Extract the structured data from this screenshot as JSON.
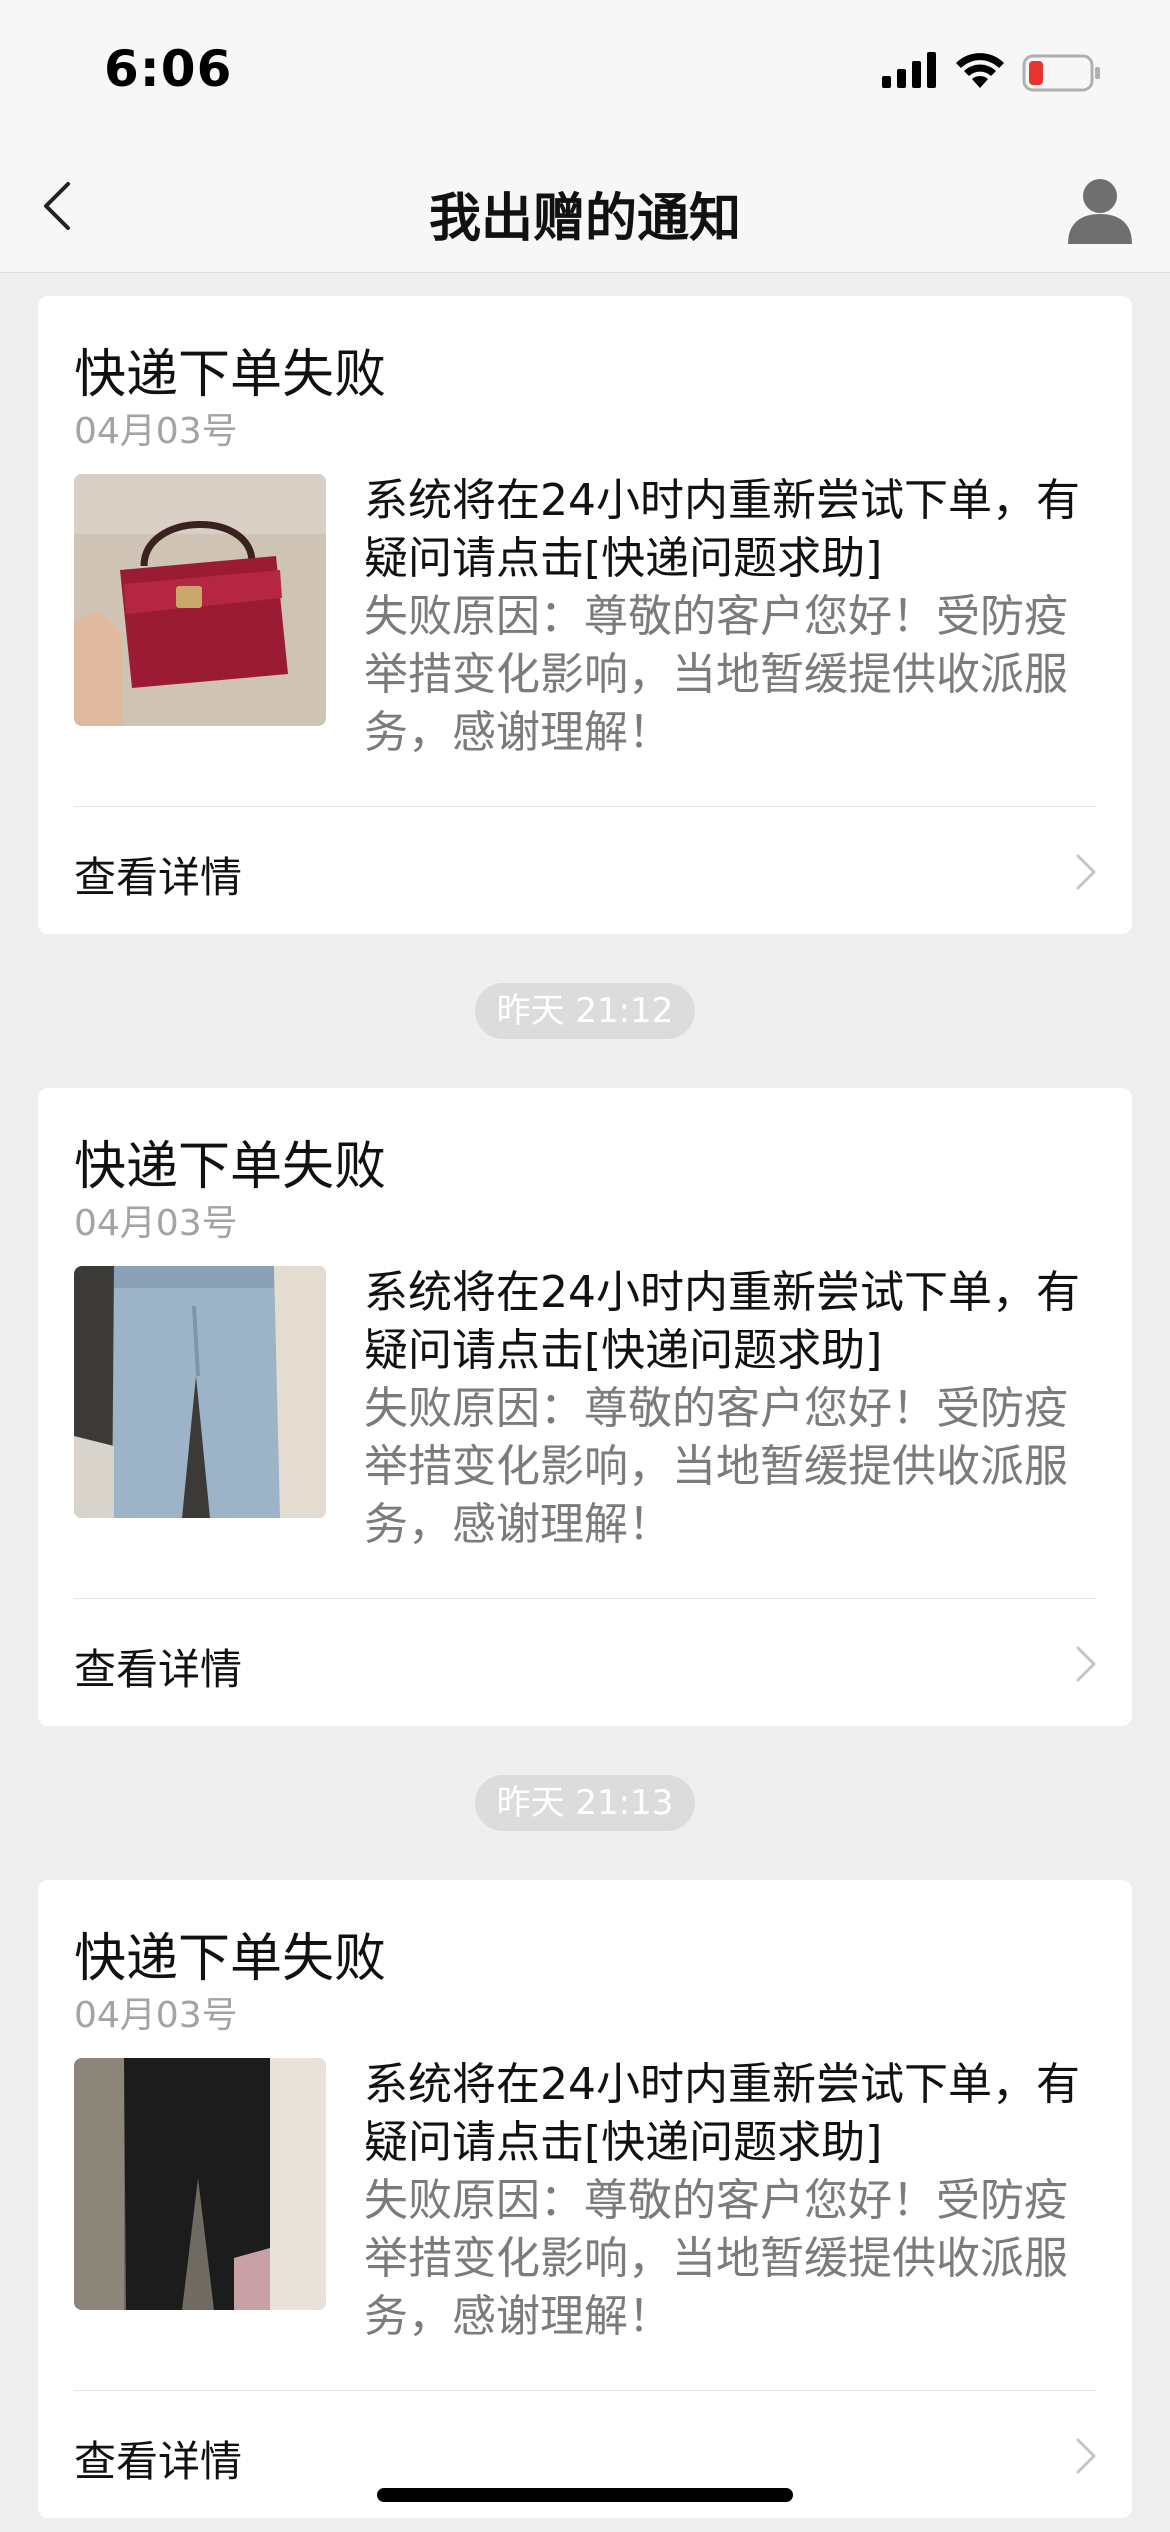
{
  "status_bar": {
    "time": "6:06",
    "battery_color": "#e5352e"
  },
  "nav": {
    "title": "我出赠的通知",
    "back_icon": "chevron-left-icon",
    "profile_icon": "user-icon"
  },
  "notifications": [
    {
      "title": "快递下单失败",
      "date": "04月03号",
      "primary_text": "系统将在24小时内重新尝试下单，有疑问请点击[快递问题求助]",
      "secondary_text": "失败原因：尊敬的客户您好！受防疫举措变化影响，当地暂缓提供收派服务，感谢理解！",
      "detail_label": "查看详情",
      "image_subject": "red handbag"
    },
    {
      "title": "快递下单失败",
      "date": "04月03号",
      "primary_text": "系统将在24小时内重新尝试下单，有疑问请点击[快递问题求助]",
      "secondary_text": "失败原因：尊敬的客户您好！受防疫举措变化影响，当地暂缓提供收派服务，感谢理解！",
      "detail_label": "查看详情",
      "image_subject": "light blue jeans"
    },
    {
      "title": "快递下单失败",
      "date": "04月03号",
      "primary_text": "系统将在24小时内重新尝试下单，有疑问请点击[快递问题求助]",
      "secondary_text": "失败原因：尊敬的客户您好！受防疫举措变化影响，当地暂缓提供收派服务，感谢理解！",
      "detail_label": "查看详情",
      "image_subject": "black trousers"
    }
  ],
  "timestamps": [
    "昨天 21:12",
    "昨天 21:13"
  ]
}
